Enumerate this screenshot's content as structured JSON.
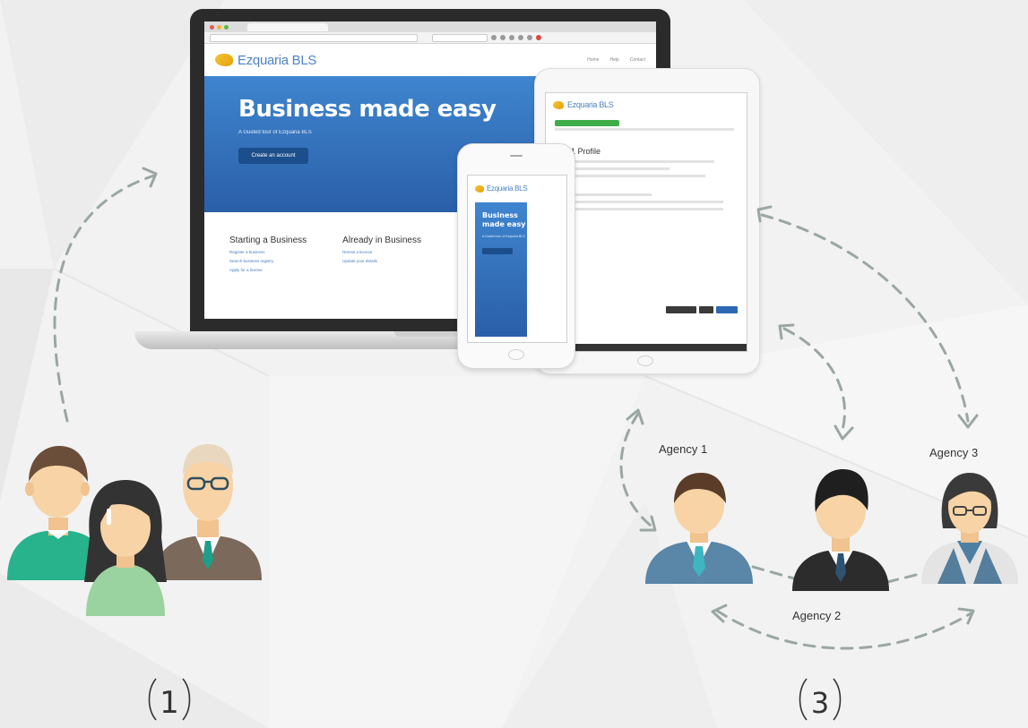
{
  "laptop": {
    "logo_text": "Ezquaria BLS",
    "hero_title": "Business made easy",
    "hero_subtitle": "A Guided tour of Ezquaria BLS",
    "hero_button": "Create an account",
    "nav_items": [
      "Home",
      "Help",
      "Contact"
    ],
    "col1_title": "Starting a Business",
    "col1_links": [
      "Register a business",
      "Search business registry",
      "Apply for a license"
    ],
    "col2_title": "Already in Business",
    "col2_links": [
      "Renew a license",
      "Update your details"
    ]
  },
  "tablet": {
    "logo_text": "Ezquaria BLS",
    "heading": "1 Profile"
  },
  "phone": {
    "logo_text": "Ezquaria BLS",
    "hero_title": "Business made easy",
    "hero_subtitle": "A Guided tour of Ezquaria BLS"
  },
  "agencies": {
    "agency1_label": "Agency 1",
    "agency2_label": "Agency 2",
    "agency3_label": "Agency 3"
  },
  "steps": {
    "left": "1",
    "right": "3"
  },
  "colors": {
    "arrow": "#9aa7a4",
    "teal": "#22a98f",
    "blue": "#3f85cf",
    "skin": "#f7d3a6",
    "green_shirt": "#28b38d",
    "light_green": "#9ad2a0"
  }
}
